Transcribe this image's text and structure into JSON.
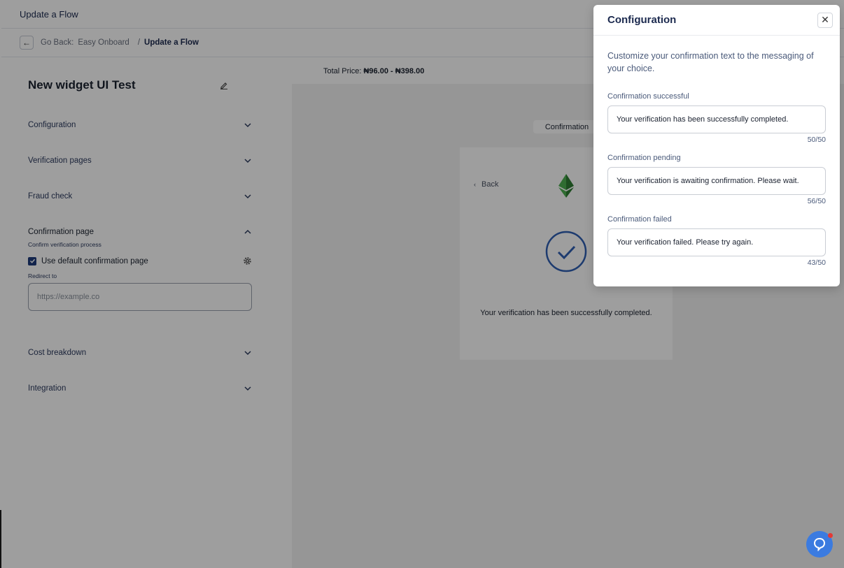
{
  "topbar": {
    "title": "Update a Flow"
  },
  "breadcrumb": {
    "go_back": "Go Back:",
    "parent": "Easy Onboard",
    "separator": "/",
    "current": "Update a Flow"
  },
  "flow": {
    "name": "New widget UI Test"
  },
  "sections": {
    "configuration": "Configuration",
    "verification_pages": "Verification pages",
    "fraud_check": "Fraud check",
    "confirmation_page": "Confirmation page",
    "confirmation_sub": "Confirm verification process",
    "use_default": "Use default confirmation page",
    "redirect_label": "Redirect to",
    "redirect_placeholder": "https://example.co",
    "cost_breakdown": "Cost breakdown",
    "integration": "Integration"
  },
  "price": {
    "label": "Total Price:",
    "value": "₦96.00 - ₦398.00"
  },
  "preview": {
    "tab": "Confirmation",
    "back": "Back",
    "message": "Your verification has been successfully completed."
  },
  "modal": {
    "title": "Configuration",
    "description": "Customize your confirmation text to the messaging of your choice.",
    "fields": [
      {
        "label": "Confirmation successful",
        "value": "Your verification has been successfully completed.",
        "counter": "50/50"
      },
      {
        "label": "Confirmation pending",
        "value": "Your verification is awaiting confirmation. Please wait.",
        "counter": "56/50"
      },
      {
        "label": "Confirmation failed",
        "value": "Your verification failed. Please try again.",
        "counter": "43/50"
      }
    ]
  },
  "colors": {
    "accent": "#1e3a7b",
    "help": "#3b7be0",
    "check": "#2f5fb3"
  },
  "icons": [
    "back-arrow-icon",
    "edit-icon",
    "chevron-down-icon",
    "chevron-up-icon",
    "checkbox-icon",
    "gear-icon",
    "ethereum-logo-icon",
    "check-circle-icon",
    "close-icon",
    "help-chat-icon"
  ]
}
